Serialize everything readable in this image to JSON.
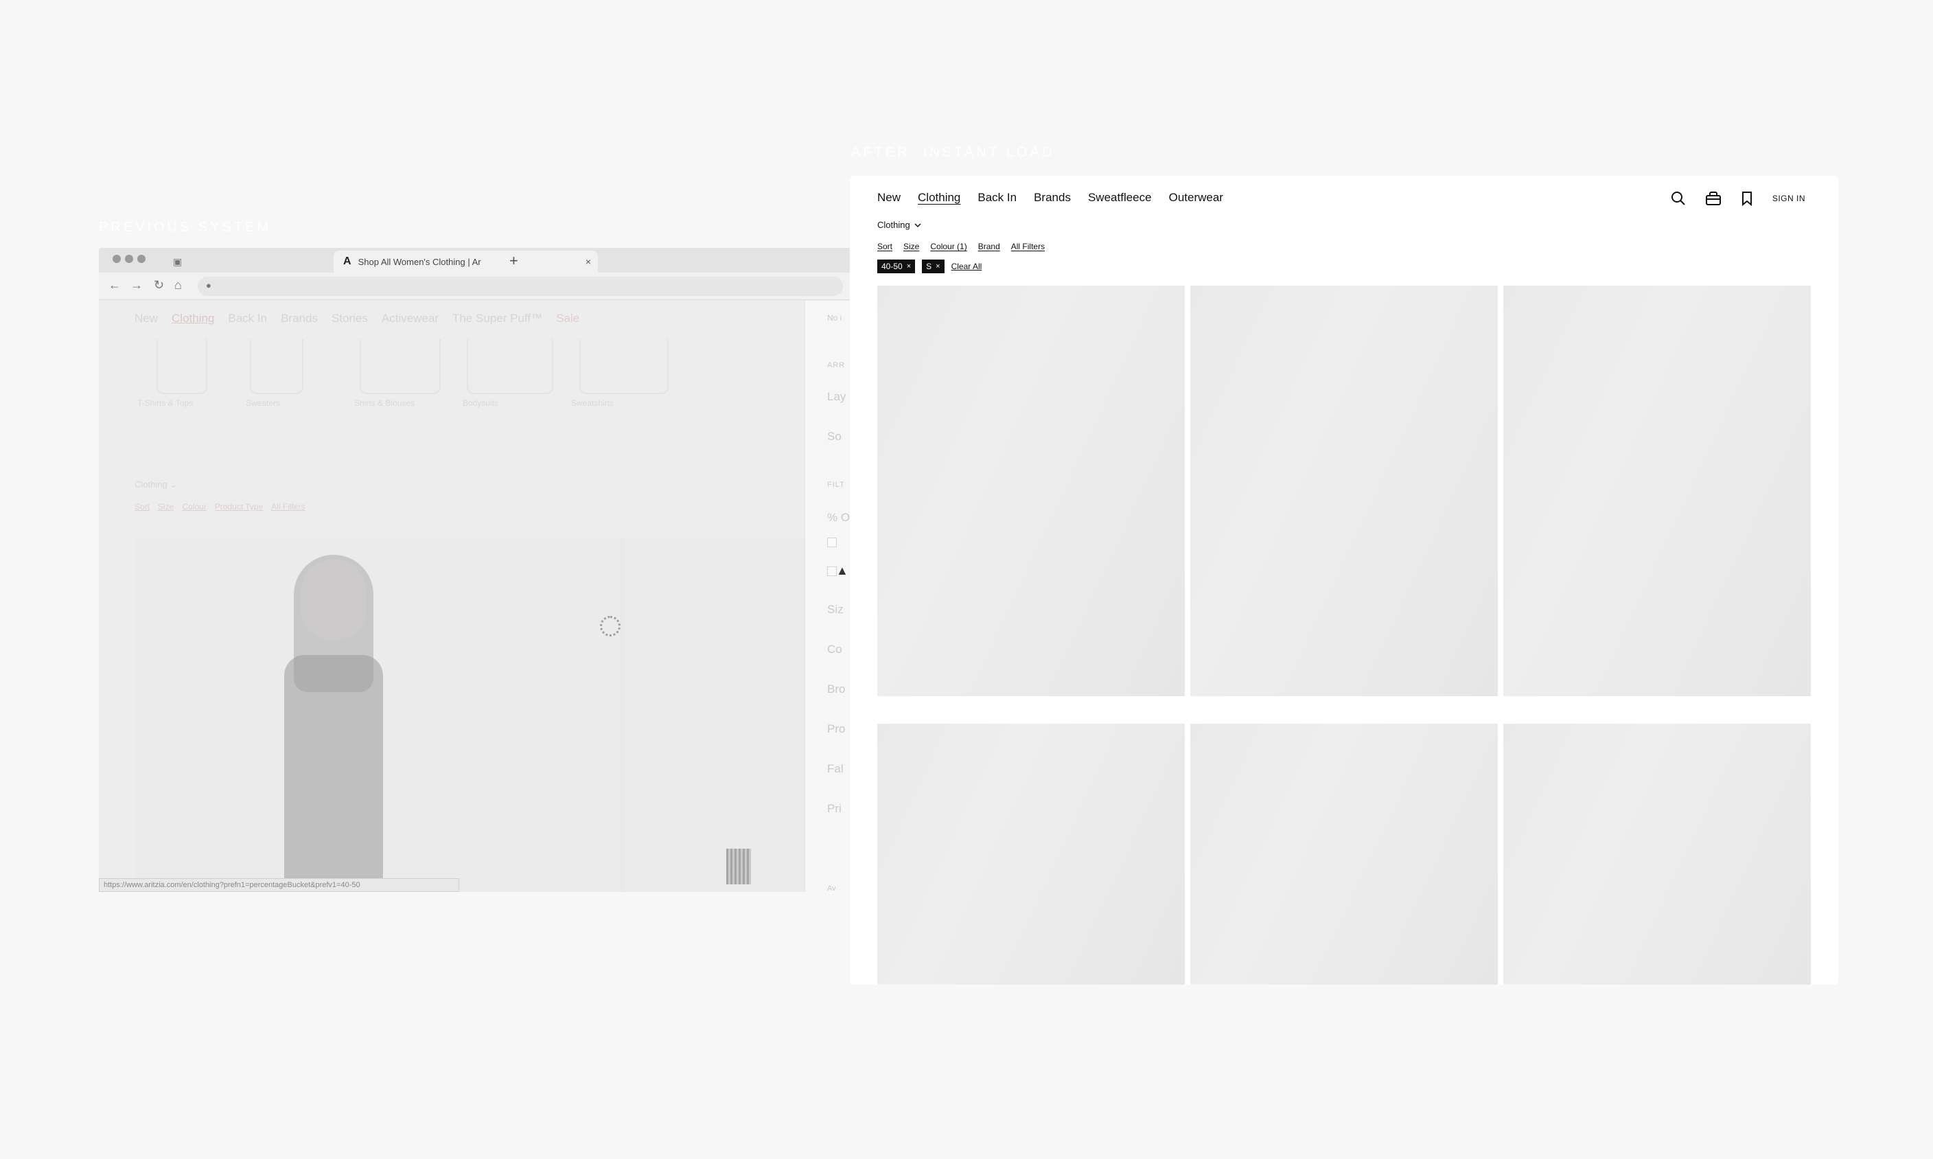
{
  "captions": {
    "left": "PREVIOUS SYSTEM",
    "right": "AFTER: INSTANT LOAD"
  },
  "browser": {
    "active_tab_title": "Shop All Women's Clothing | Ar",
    "tab_logo": "A",
    "tab_close": "×",
    "new_tab": "+",
    "status_url": "https://www.aritzia.com/en/clothing?prefn1=percentageBucket&prefv1=40-50",
    "nav_glyphs": {
      "back": "←",
      "forward": "→",
      "reload": "↻",
      "home": "⌂",
      "lock": "🔒"
    }
  },
  "old_page": {
    "nav": [
      "New",
      "Clothing",
      "Back In",
      "Brands",
      "Stories",
      "Activewear",
      "The Super Puff™",
      "Sale"
    ],
    "categories": [
      "T-Shirts & Tops",
      "Sweaters",
      "Shirts & Blouses",
      "Bodysuits",
      "Sweatshirts"
    ],
    "brand_select": "Clothing ⌄",
    "filters": [
      "Sort",
      "Size",
      "Colour",
      "Product Type",
      "All Filters"
    ],
    "side_panel": {
      "heading": "No i",
      "section_arrange": "ARR",
      "arrange_items": [
        "Lay",
        "So"
      ],
      "section_filter": "FILT",
      "filter_items": [
        "% O",
        "Siz",
        "Co",
        "Bro",
        "Pro",
        "Fal",
        "Pri"
      ],
      "bottom_label": "Av"
    }
  },
  "new_page": {
    "nav": [
      "New",
      "Clothing",
      "Back In",
      "Brands",
      "Sweatfleece",
      "Outerwear"
    ],
    "active_nav": "Clothing",
    "sign_in": "SIGN IN",
    "brand_select": "Clothing",
    "filters": [
      "Sort",
      "Size",
      "Colour (1)",
      "Brand",
      "All Filters"
    ],
    "chips": [
      {
        "label": "40-50",
        "remove": "×"
      },
      {
        "label": "S",
        "remove": "×"
      }
    ],
    "clear_all": "Clear All",
    "icons": [
      "search-icon",
      "bag-icon",
      "bookmark-icon"
    ]
  }
}
